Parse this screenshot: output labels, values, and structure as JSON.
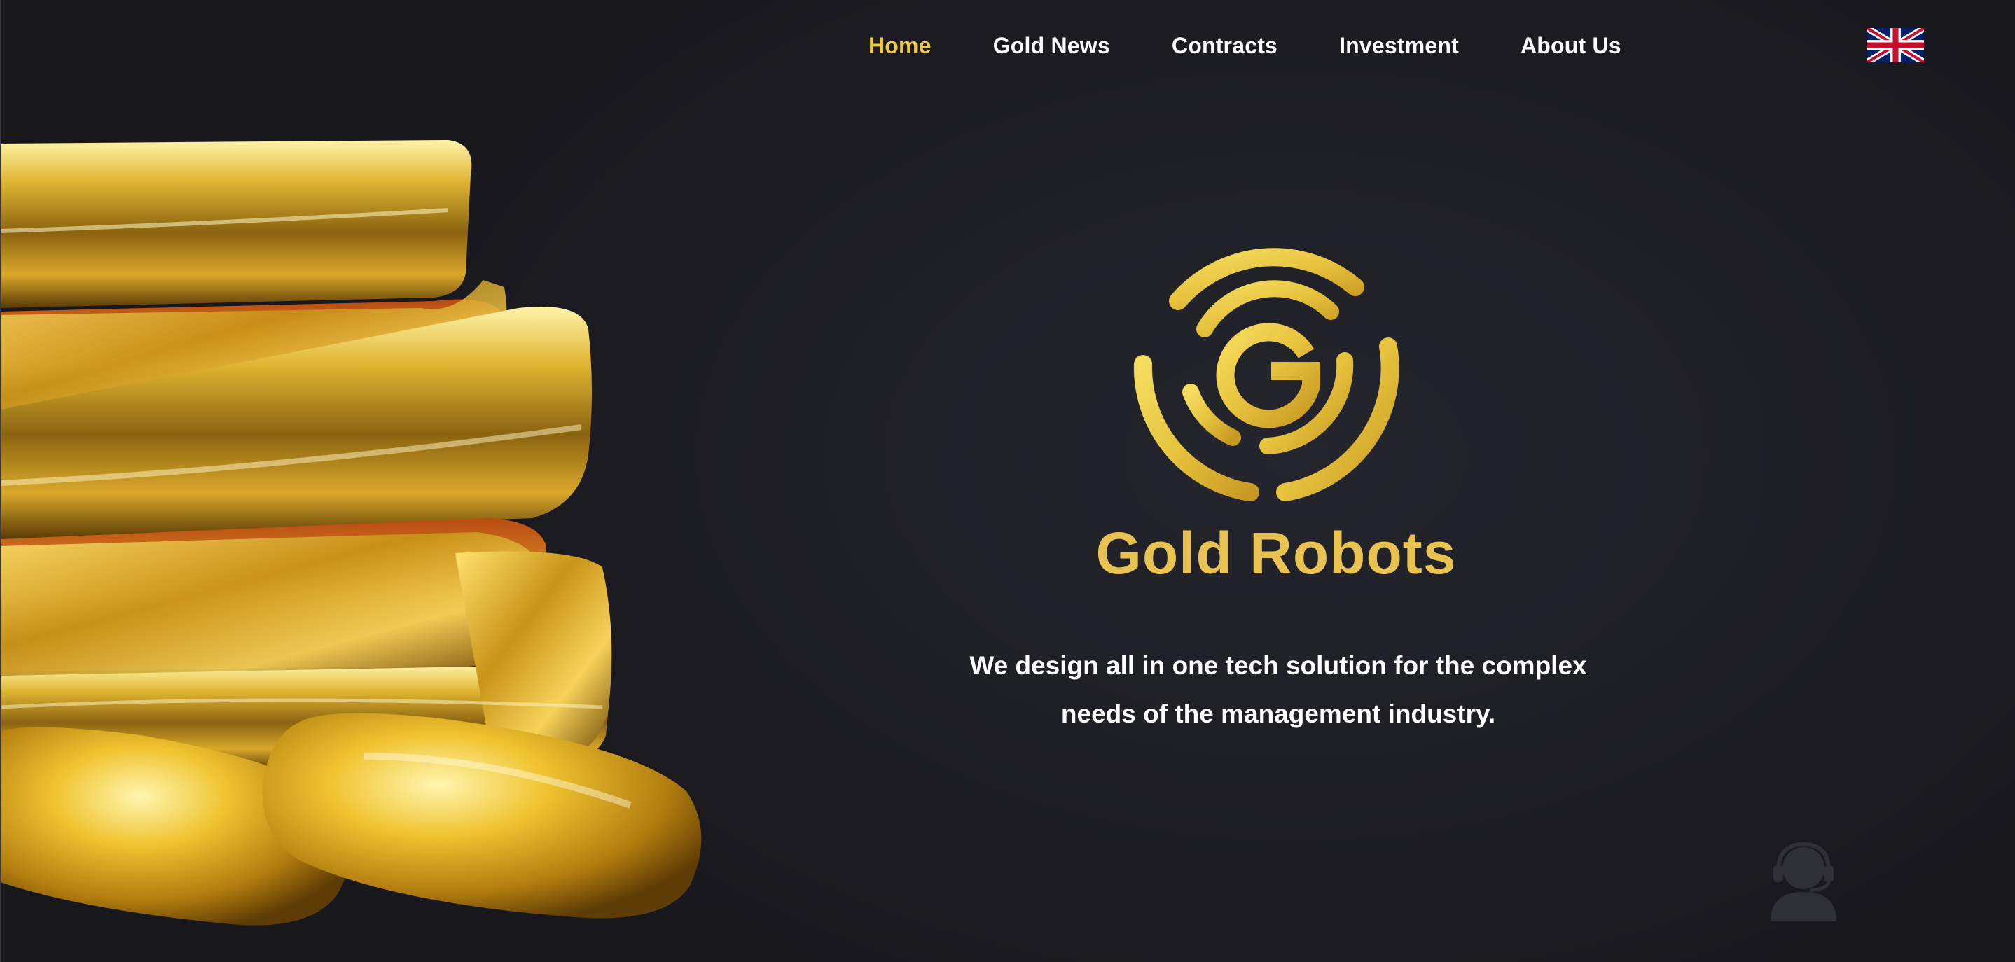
{
  "nav": {
    "items": [
      {
        "label": "Home",
        "active": true
      },
      {
        "label": "Gold News",
        "active": false
      },
      {
        "label": "Contracts",
        "active": false
      },
      {
        "label": "Investment",
        "active": false
      },
      {
        "label": "About Us",
        "active": false
      }
    ],
    "language_flag_icon": "uk-flag-icon"
  },
  "hero": {
    "logo_icon": "gold-robots-logo-icon",
    "brand_name": "Gold Robots",
    "tagline_line1": "We design all in one tech solution for the complex",
    "tagline_line2": "needs of the management industry."
  },
  "support": {
    "icon": "customer-support-icon"
  },
  "colors": {
    "accent_gold": "#f0c93e",
    "brand_gold": "#e9c352",
    "background": "#1c1c22",
    "text": "#ffffff"
  }
}
